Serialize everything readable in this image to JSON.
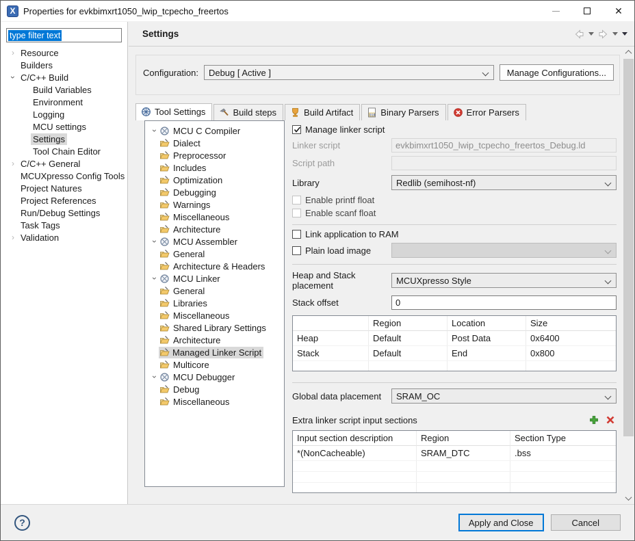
{
  "window": {
    "title": "Properties for evkbimxrt1050_lwip_tcpecho_freertos"
  },
  "sidebar": {
    "filter_placeholder": "type filter text",
    "items": [
      {
        "label": "Resource",
        "state": "collapsed"
      },
      {
        "label": "Builders"
      },
      {
        "label": "C/C++ Build",
        "state": "expanded"
      },
      {
        "label": "Build Variables"
      },
      {
        "label": "Environment"
      },
      {
        "label": "Logging"
      },
      {
        "label": "MCU settings"
      },
      {
        "label": "Settings",
        "selected": true
      },
      {
        "label": "Tool Chain Editor"
      },
      {
        "label": "C/C++ General",
        "state": "collapsed"
      },
      {
        "label": "MCUXpresso Config Tools"
      },
      {
        "label": "Project Natures"
      },
      {
        "label": "Project References"
      },
      {
        "label": "Run/Debug Settings"
      },
      {
        "label": "Task Tags"
      },
      {
        "label": "Validation",
        "state": "collapsed"
      }
    ]
  },
  "header": {
    "title": "Settings"
  },
  "configuration": {
    "label": "Configuration:",
    "value": "Debug  [ Active ]",
    "manage_button": "Manage Configurations..."
  },
  "tabs": [
    {
      "label": "Tool Settings",
      "icon": "tool-settings-icon",
      "active": true
    },
    {
      "label": "Build steps",
      "icon": "build-steps-icon",
      "active": false
    },
    {
      "label": "Build Artifact",
      "icon": "build-artifact-icon",
      "active": false
    },
    {
      "label": "Binary Parsers",
      "icon": "binary-parsers-icon",
      "active": false
    },
    {
      "label": "Error Parsers",
      "icon": "error-parsers-icon",
      "active": false
    }
  ],
  "tool_tree": {
    "rows": [
      {
        "type": "group",
        "label": "MCU C Compiler",
        "state": "expanded"
      },
      {
        "type": "leaf",
        "label": "Dialect"
      },
      {
        "type": "leaf",
        "label": "Preprocessor"
      },
      {
        "type": "leaf",
        "label": "Includes"
      },
      {
        "type": "leaf",
        "label": "Optimization"
      },
      {
        "type": "leaf",
        "label": "Debugging"
      },
      {
        "type": "leaf",
        "label": "Warnings"
      },
      {
        "type": "leaf",
        "label": "Miscellaneous"
      },
      {
        "type": "leaf",
        "label": "Architecture"
      },
      {
        "type": "group",
        "label": "MCU Assembler",
        "state": "expanded"
      },
      {
        "type": "leaf",
        "label": "General"
      },
      {
        "type": "leaf",
        "label": "Architecture & Headers"
      },
      {
        "type": "group",
        "label": "MCU Linker",
        "state": "expanded"
      },
      {
        "type": "leaf",
        "label": "General"
      },
      {
        "type": "leaf",
        "label": "Libraries"
      },
      {
        "type": "leaf",
        "label": "Miscellaneous"
      },
      {
        "type": "leaf",
        "label": "Shared Library Settings"
      },
      {
        "type": "leaf",
        "label": "Architecture"
      },
      {
        "type": "leaf",
        "label": "Managed Linker Script",
        "selected": true
      },
      {
        "type": "leaf",
        "label": "Multicore"
      },
      {
        "type": "group",
        "label": "MCU Debugger",
        "state": "expanded"
      },
      {
        "type": "leaf",
        "label": "Debug"
      },
      {
        "type": "leaf",
        "label": "Miscellaneous"
      }
    ]
  },
  "panel": {
    "manage_linker_script": {
      "label": "Manage linker script",
      "checked": true
    },
    "linker_script": {
      "label": "Linker script",
      "value": "evkbimxrt1050_lwip_tcpecho_freertos_Debug.ld",
      "disabled": true
    },
    "script_path": {
      "label": "Script path",
      "value": "",
      "disabled": true
    },
    "library": {
      "label": "Library",
      "value": "Redlib (semihost-nf)"
    },
    "enable_printf_float": {
      "label": "Enable printf float",
      "checked": false,
      "disabled": true
    },
    "enable_scanf_float": {
      "label": "Enable scanf float",
      "checked": false,
      "disabled": true
    },
    "link_to_ram": {
      "label": "Link application to RAM",
      "checked": false
    },
    "plain_load_image": {
      "label": "Plain load image",
      "checked": false,
      "value": ""
    },
    "heap_stack_placement": {
      "label": "Heap and Stack placement",
      "value": "MCUXpresso Style"
    },
    "stack_offset": {
      "label": "Stack offset",
      "value": "0"
    },
    "heap_stack_table": {
      "columns": [
        "",
        "Region",
        "Location",
        "Size"
      ],
      "rows": [
        [
          "Heap",
          "Default",
          "Post Data",
          "0x6400"
        ],
        [
          "Stack",
          "Default",
          "End",
          "0x800"
        ]
      ]
    },
    "global_data_placement": {
      "label": "Global data placement",
      "value": "SRAM_OC"
    },
    "extra_sections": {
      "label": "Extra linker script input sections",
      "columns": [
        "Input section description",
        "Region",
        "Section Type"
      ],
      "rows": [
        [
          "*(NonCacheable)",
          "SRAM_DTC",
          ".bss"
        ]
      ]
    }
  },
  "footer": {
    "help": "?",
    "apply_close": "Apply and Close",
    "cancel": "Cancel"
  },
  "colors": {
    "accent": "#0078d7",
    "selection_gray": "#d9d9d9",
    "add_green": "#3f9c35",
    "delete_red": "#d23b33",
    "artifact_yellow": "#e8a33d"
  }
}
